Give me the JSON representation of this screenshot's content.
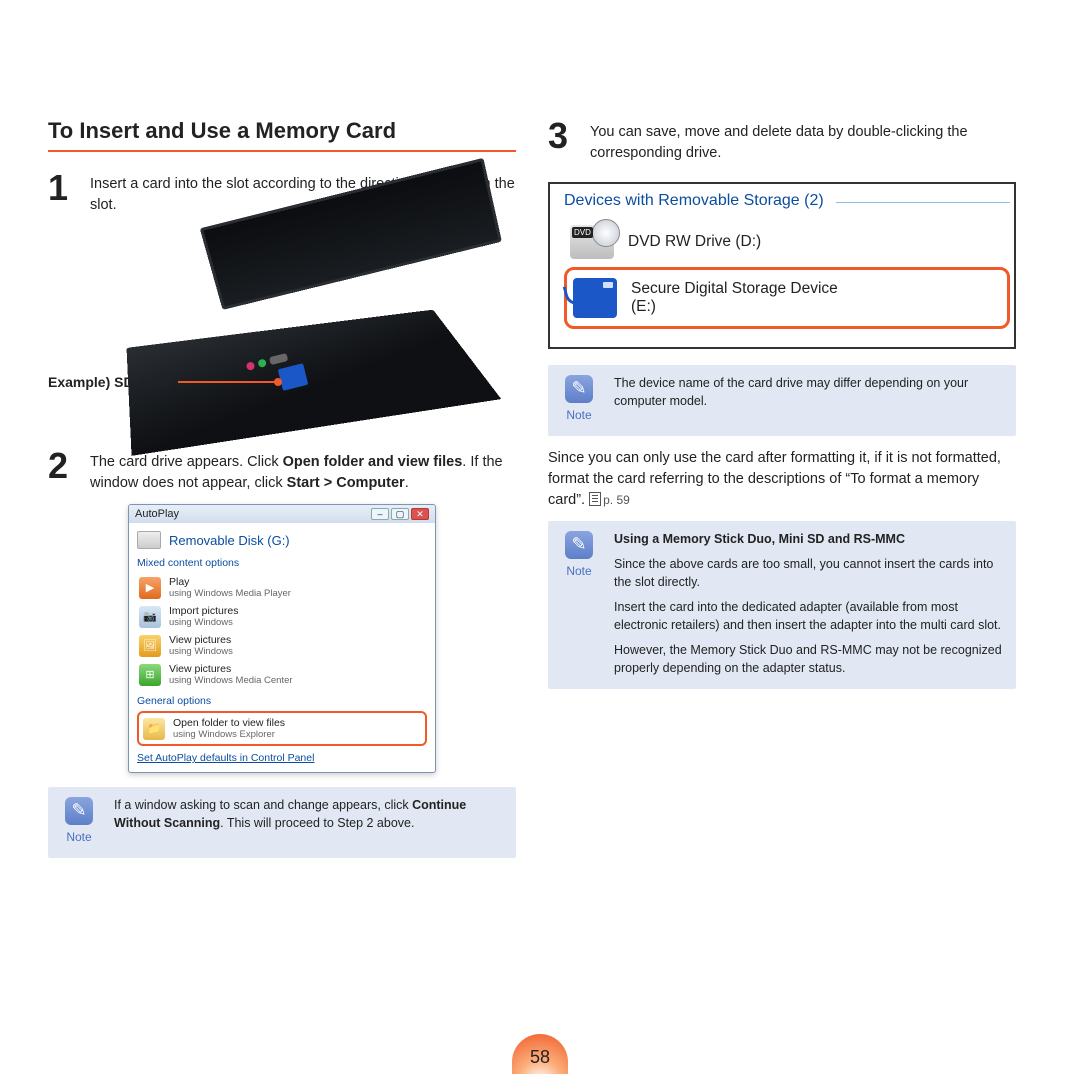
{
  "heading": "To Insert and Use a Memory Card",
  "step1": {
    "num": "1",
    "text": "Insert a card into the slot according to the directions printed on the slot."
  },
  "sd_label": "Example) SD Card",
  "step2": {
    "num": "2",
    "pre": "The card drive appears. Click ",
    "b1": "Open folder and view files",
    "mid": ". If the window does not appear, click ",
    "b2": "Start > Computer",
    "end": "."
  },
  "autoplay": {
    "title": "AutoPlay",
    "disk": "Removable Disk (G:)",
    "mixed": "Mixed content options",
    "opts": [
      {
        "t1": "Play",
        "t2": "using Windows Media Player",
        "icon": "play"
      },
      {
        "t1": "Import pictures",
        "t2": "using Windows",
        "icon": "cam"
      },
      {
        "t1": "View pictures",
        "t2": "using Windows",
        "icon": "pics"
      },
      {
        "t1": "View pictures",
        "t2": "using Windows Media Center",
        "icon": "mce"
      }
    ],
    "general": "General options",
    "open": {
      "t1": "Open folder to view files",
      "t2": "using Windows Explorer"
    },
    "link": "Set AutoPlay defaults in Control Panel"
  },
  "note1": {
    "label": "Note",
    "pre": "If a window asking to scan and change appears, click ",
    "b": "Continue Without Scanning",
    "post": ". This will proceed to Step 2 above."
  },
  "step3": {
    "num": "3",
    "text": "You can save, move and delete data by double-clicking the corresponding drive."
  },
  "devices": {
    "legend": "Devices with Removable Storage (2)",
    "dvd": "DVD RW Drive (D:)",
    "sd_line1": "Secure Digital Storage Device",
    "sd_line2": "(E:)"
  },
  "note2": {
    "label": "Note",
    "text": "The device name of the card drive may differ depending on your computer model."
  },
  "para": {
    "text": "Since you can only use the card after formatting it, if it is not formatted, format the card referring to the descriptions of “To format a memory card”.",
    "ref": "p. 59"
  },
  "note3": {
    "label": "Note",
    "title": "Using a Memory Stick Duo, Mini SD and RS-MMC",
    "p1": "Since the above cards are too small, you cannot insert the cards into the slot directly.",
    "p2": "Insert the card into the dedicated adapter (available from most electronic retailers) and then insert the adapter into the multi card slot.",
    "p3": "However, the Memory Stick Duo and RS-MMC may not be recognized properly depending on the adapter status."
  },
  "page_number": "58"
}
